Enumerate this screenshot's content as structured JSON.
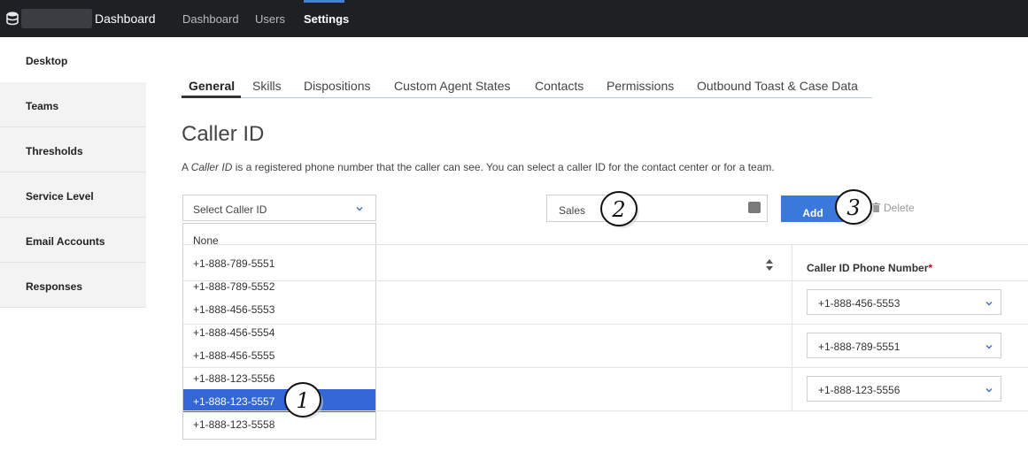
{
  "header": {
    "app_title": "Dashboard",
    "nav": [
      "Dashboard",
      "Users",
      "Settings"
    ],
    "active_nav": "Settings"
  },
  "sidebar": {
    "items": [
      "Desktop",
      "Teams",
      "Thresholds",
      "Service Level",
      "Email Accounts",
      "Responses"
    ],
    "active": "Desktop"
  },
  "tabs": {
    "items": [
      "General",
      "Skills",
      "Dispositions",
      "Custom Agent States",
      "Contacts",
      "Permissions",
      "Outbound Toast & Case Data"
    ],
    "active": "General"
  },
  "page": {
    "title": "Caller ID",
    "desc_prefix": "A ",
    "desc_term": "Caller ID",
    "desc_rest": " is a registered phone number that the caller can see. You can select a caller ID for the contact center or for a team."
  },
  "controls": {
    "select_placeholder": "Select Caller ID",
    "name_value": "Sales",
    "add_label": "Add",
    "delete_label": "Delete"
  },
  "dropdown": {
    "options": [
      "None",
      "+1-888-789-5551",
      "+1-888-789-5552",
      "+1-888-456-5553",
      "+1-888-456-5554",
      "+1-888-456-5555",
      "+1-888-123-5556",
      "+1-888-123-5557",
      "+1-888-123-5558"
    ],
    "selected": "+1-888-123-5557"
  },
  "table": {
    "column_header": "Caller ID Phone Number",
    "required_mark": "*",
    "rows": [
      "+1-888-456-5553",
      "+1-888-789-5551",
      "+1-888-123-5556"
    ]
  },
  "callouts": [
    "1",
    "2",
    "3"
  ],
  "colors": {
    "topbar": "#1e2023",
    "accent": "#3a78dc",
    "selected_option": "#3367d6"
  }
}
